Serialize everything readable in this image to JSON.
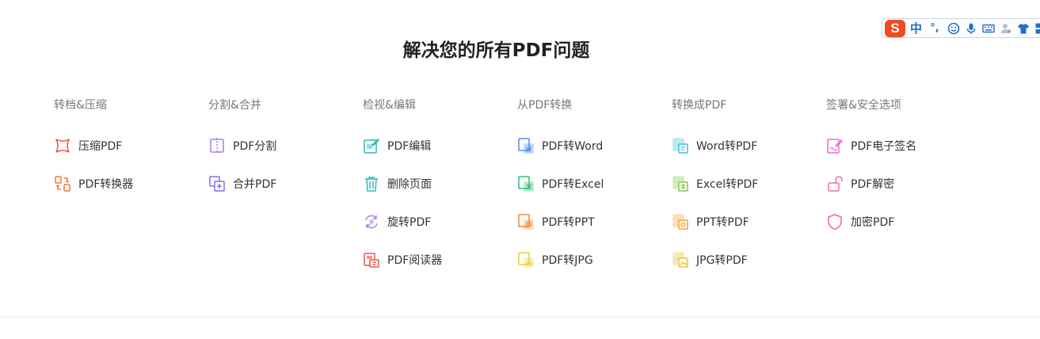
{
  "title": "解决您的所有PDF问题",
  "ime": {
    "logo": "S",
    "lang": "中",
    "punct": "°,"
  },
  "columns": [
    {
      "title": "转档&压缩",
      "tools": [
        {
          "label": "压缩PDF",
          "icon": "compress-icon",
          "color": "#e8544e"
        },
        {
          "label": "PDF转换器",
          "icon": "convert-icon",
          "color": "#f07a3a"
        }
      ]
    },
    {
      "title": "分割&合并",
      "tools": [
        {
          "label": "PDF分割",
          "icon": "split-icon",
          "color": "#a77cf0"
        },
        {
          "label": "合并PDF",
          "icon": "merge-icon",
          "color": "#8a6de8"
        }
      ]
    },
    {
      "title": "检视&编辑",
      "tools": [
        {
          "label": "PDF编辑",
          "icon": "edit-icon",
          "color": "#2fb6b8"
        },
        {
          "label": "删除页面",
          "icon": "trash-icon",
          "color": "#2fb6b8"
        },
        {
          "label": "旋转PDF",
          "icon": "rotate-icon",
          "color": "#a77cf0"
        },
        {
          "label": "PDF阅读器",
          "icon": "reader-icon",
          "color": "#e8544e"
        }
      ]
    },
    {
      "title": "从PDF转换",
      "tools": [
        {
          "label": "PDF转Word",
          "icon": "pdf-to-word-icon",
          "color": "#4a8ef0"
        },
        {
          "label": "PDF转Excel",
          "icon": "pdf-to-excel-icon",
          "color": "#2fbf71"
        },
        {
          "label": "PDF转PPT",
          "icon": "pdf-to-ppt-icon",
          "color": "#f08a3a"
        },
        {
          "label": "PDF转JPG",
          "icon": "pdf-to-jpg-icon",
          "color": "#e8d23a"
        }
      ]
    },
    {
      "title": "转换成PDF",
      "tools": [
        {
          "label": "Word转PDF",
          "icon": "word-to-pdf-icon",
          "color": "#3bc0e0"
        },
        {
          "label": "Excel转PDF",
          "icon": "excel-to-pdf-icon",
          "color": "#7fc94a"
        },
        {
          "label": "PPT转PDF",
          "icon": "ppt-to-pdf-icon",
          "color": "#f0a23a"
        },
        {
          "label": "JPG转PDF",
          "icon": "jpg-to-pdf-icon",
          "color": "#e8c23a"
        }
      ]
    },
    {
      "title": "签署&安全选项",
      "tools": [
        {
          "label": "PDF电子签名",
          "icon": "signature-icon",
          "color": "#e86ed0"
        },
        {
          "label": "PDF解密",
          "icon": "unlock-icon",
          "color": "#f06ea0"
        },
        {
          "label": "加密PDF",
          "icon": "shield-icon",
          "color": "#f06a7a"
        }
      ]
    }
  ]
}
